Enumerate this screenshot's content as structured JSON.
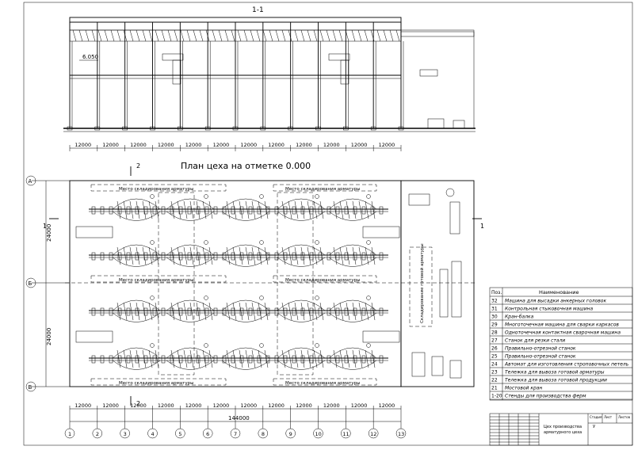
{
  "section": {
    "label": "1-1",
    "elevation_mark": "6.050"
  },
  "plan": {
    "title": "План цеха на отметке 0.000",
    "cut_marks": [
      "2",
      "2",
      "1",
      "1"
    ],
    "row_axes": [
      "А",
      "Б",
      "В"
    ],
    "row_spans": [
      "24000",
      "24000"
    ],
    "storage_labels": [
      "Место складирования арматуры",
      "Место складирования арматуры",
      "Место складирования арматуры",
      "Место складирования арматуры",
      "Место складирования арматуры",
      "Место складирования арматуры"
    ],
    "vertical_storage": "Складирование готовой арматуры",
    "col_spans": [
      "12000",
      "12000",
      "12000",
      "12000",
      "12000",
      "12000",
      "12000",
      "12000",
      "12000",
      "12000",
      "12000",
      "12000"
    ],
    "total_span": "144000",
    "col_axes": [
      "1",
      "2",
      "3",
      "4",
      "5",
      "6",
      "7",
      "8",
      "9",
      "10",
      "11",
      "12",
      "13"
    ]
  },
  "section_spans": [
    "12000",
    "12000",
    "12000",
    "12000",
    "12000",
    "12000",
    "12000",
    "12000",
    "12000",
    "12000",
    "12000",
    "12000"
  ],
  "legend": {
    "header_pos": "Поз.",
    "header_name": "Наименование",
    "rows": [
      {
        "pos": "32",
        "name": "Машина для высадки анкерных головок"
      },
      {
        "pos": "31",
        "name": "Контрольная стыковочная машина"
      },
      {
        "pos": "30",
        "name": "Кран-балка"
      },
      {
        "pos": "29",
        "name": "Многоточечная машина для сварки каркасов"
      },
      {
        "pos": "28",
        "name": "Одноточечная контактная сварочная машина"
      },
      {
        "pos": "27",
        "name": "Станок для резки стали"
      },
      {
        "pos": "26",
        "name": "Правильно-отрезной станок"
      },
      {
        "pos": "25",
        "name": "Правильно-отрезной станок"
      },
      {
        "pos": "24",
        "name": "Автомат для изготовления строповочных петель"
      },
      {
        "pos": "23",
        "name": "Тележка для вывоза готовой арматуры"
      },
      {
        "pos": "22",
        "name": "Тележка для вывоза готовой продукции"
      },
      {
        "pos": "21",
        "name": "Мостовой кран"
      },
      {
        "pos": "1-20",
        "name": "Стенды для производства ферм"
      }
    ]
  },
  "stamp": {
    "title_line1": "Цех производства",
    "title_line2": "арматурного цеха",
    "stage_label": "Стадия",
    "stage_value": "У",
    "sheet_label": "Лист",
    "sheets_label": "Листов"
  }
}
